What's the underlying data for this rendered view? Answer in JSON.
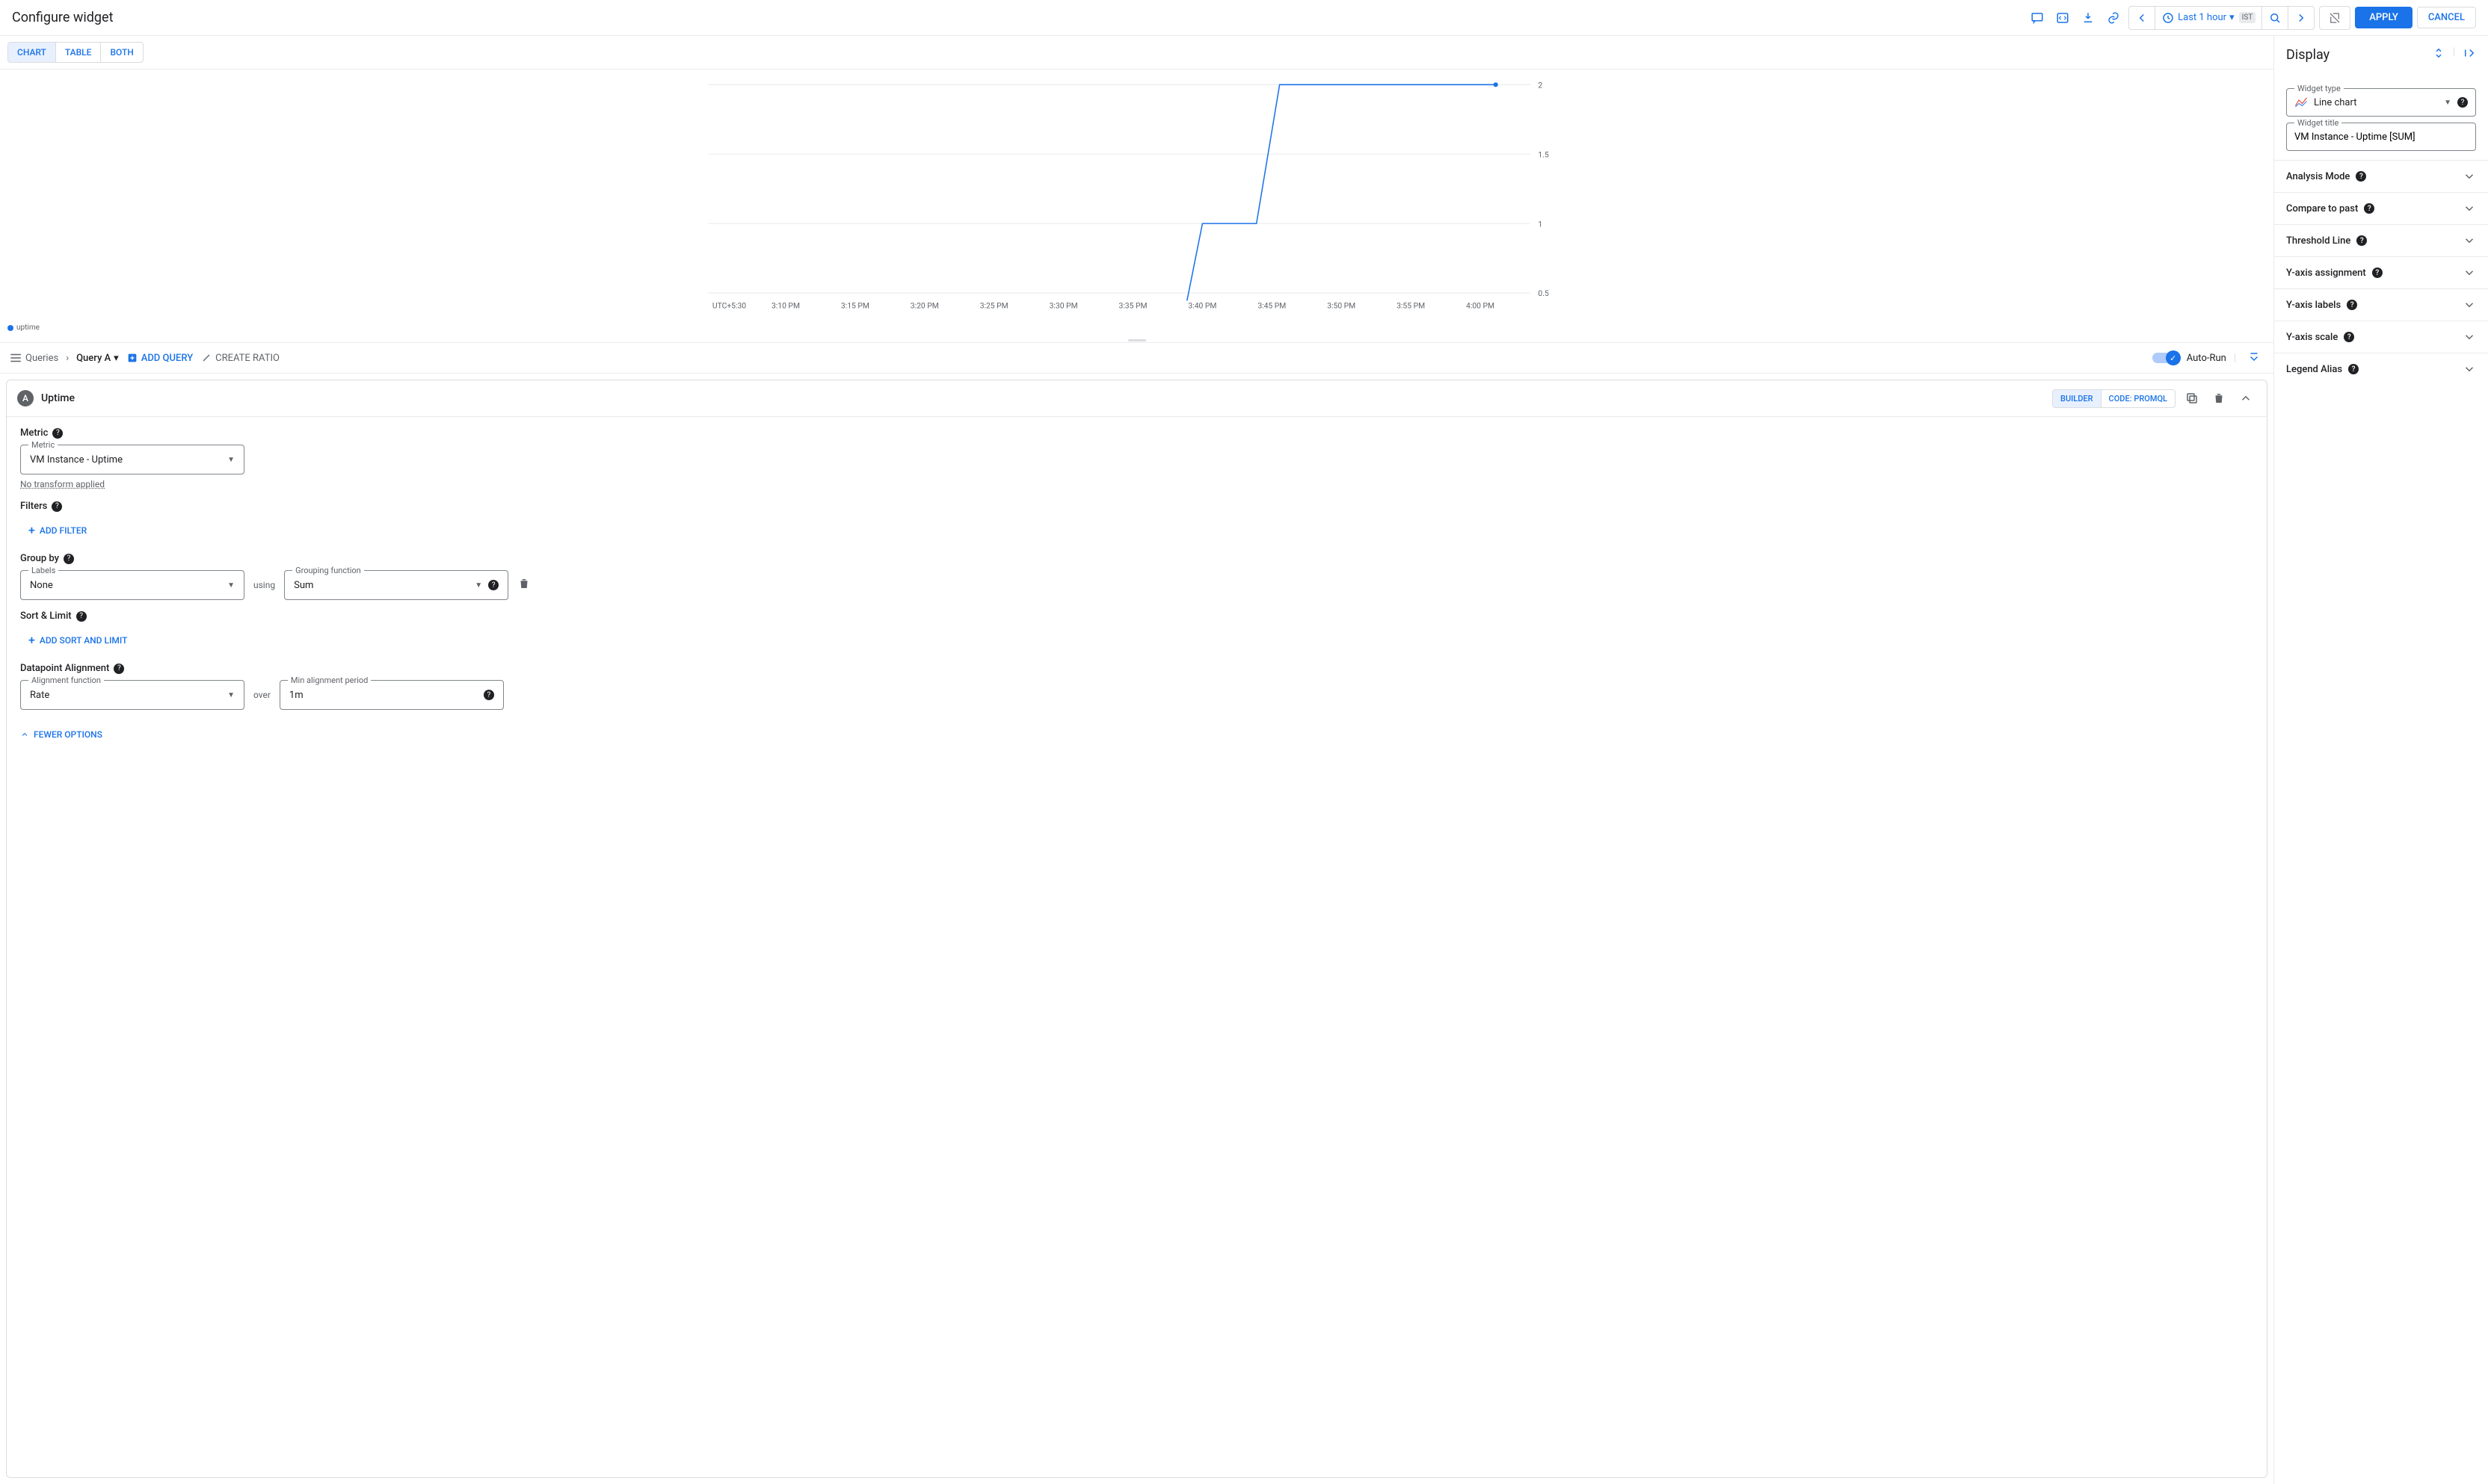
{
  "header": {
    "title": "Configure widget",
    "time_range": "Last 1 hour",
    "tz_badge": "IST",
    "apply": "APPLY",
    "cancel": "CANCEL"
  },
  "view_tabs": {
    "chart": "CHART",
    "table": "TABLE",
    "both": "BOTH"
  },
  "chart_data": {
    "type": "line",
    "series": [
      {
        "name": "uptime",
        "x_labels": [
          "3:10 PM",
          "3:15 PM",
          "3:20 PM",
          "3:25 PM",
          "3:30 PM",
          "3:35 PM",
          "3:40 PM",
          "3:45 PM",
          "3:50 PM",
          "3:55 PM",
          "4:00 PM"
        ],
        "points": [
          {
            "t": "3:38 PM",
            "v": 0
          },
          {
            "t": "3:40 PM",
            "v": 1
          },
          {
            "t": "3:42 PM",
            "v": 1
          },
          {
            "t": "3:44 PM",
            "v": 2
          },
          {
            "t": "4:00 PM",
            "v": 2
          }
        ]
      }
    ],
    "ylim": [
      0.5,
      2
    ],
    "y_ticks": [
      0.5,
      1,
      1.5,
      2
    ],
    "timezone": "UTC+5:30",
    "x_ticks": [
      "3:10 PM",
      "3:15 PM",
      "3:20 PM",
      "3:25 PM",
      "3:30 PM",
      "3:35 PM",
      "3:40 PM",
      "3:45 PM",
      "3:50 PM",
      "3:55 PM",
      "4:00 PM"
    ]
  },
  "legend": {
    "series": "uptime"
  },
  "query_bar": {
    "queries": "Queries",
    "query_a": "Query A",
    "add_query": "ADD QUERY",
    "create_ratio": "CREATE RATIO",
    "auto_run": "Auto-Run"
  },
  "query_panel": {
    "badge": "A",
    "title": "Uptime",
    "builder": "BUILDER",
    "code": "CODE: PROMQL",
    "metric_hdr": "Metric",
    "metric_field_label": "Metric",
    "metric_value": "VM Instance - Uptime",
    "no_transform": "No transform applied",
    "filters_hdr": "Filters",
    "add_filter": "ADD FILTER",
    "groupby_hdr": "Group by",
    "labels_field_label": "Labels",
    "labels_value": "None",
    "using": "using",
    "grouping_fn_label": "Grouping function",
    "grouping_fn_value": "Sum",
    "sort_hdr": "Sort & Limit",
    "add_sort": "ADD SORT AND LIMIT",
    "alignment_hdr": "Datapoint Alignment",
    "align_fn_label": "Alignment function",
    "align_fn_value": "Rate",
    "over": "over",
    "min_period_label": "Min alignment period",
    "min_period_value": "1m",
    "fewer": "FEWER OPTIONS"
  },
  "display": {
    "title": "Display",
    "widget_type_label": "Widget type",
    "widget_type_value": "Line chart",
    "widget_title_label": "Widget title",
    "widget_title_value": "VM Instance - Uptime [SUM]",
    "sections": {
      "analysis": "Analysis Mode",
      "compare": "Compare to past",
      "threshold": "Threshold Line",
      "yassign": "Y-axis assignment",
      "ylabels": "Y-axis labels",
      "yscale": "Y-axis scale",
      "legend": "Legend Alias"
    }
  }
}
